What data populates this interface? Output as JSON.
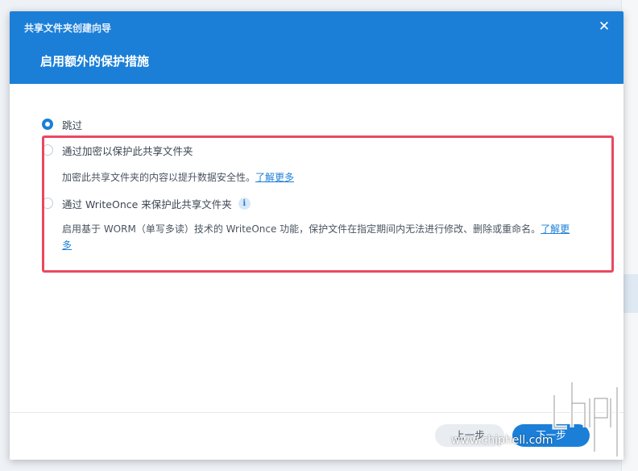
{
  "dialog": {
    "title": "共享文件夹创建向导",
    "close_icon": "close-icon",
    "step_title": "启用额外的保护措施"
  },
  "options": [
    {
      "label": "跳过",
      "checked": true
    },
    {
      "label": "通过加密以保护此共享文件夹",
      "checked": false,
      "description": "加密此共享文件夹的内容以提升数据安全性。",
      "link": "了解更多"
    },
    {
      "label": "通过 WriteOnce 来保护此共享文件夹",
      "checked": false,
      "info_icon": "info-icon",
      "info_glyph": "i",
      "description": "启用基于 WORM（单写多读）技术的 WriteOnce 功能，保护文件在指定期间内无法进行修改、删除或重命名。",
      "link_part1": "了解更",
      "link_part2": "多"
    }
  ],
  "footer": {
    "prev_label": "上一步",
    "next_label": "下一步"
  },
  "watermark": {
    "text": "www.chiphell.com"
  },
  "colors": {
    "accent": "#1b7fd8",
    "highlight": "#ea4860"
  }
}
